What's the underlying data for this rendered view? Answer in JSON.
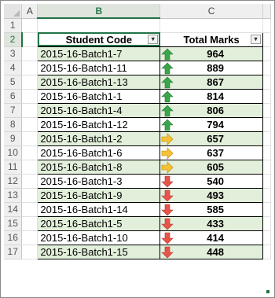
{
  "columns": [
    "A",
    "B",
    "C"
  ],
  "header": {
    "code": "Student Code",
    "marks": "Total Marks"
  },
  "rows": [
    {
      "n": "3",
      "code": "2015-16-Batch1-7",
      "marks": "964",
      "trend": "up"
    },
    {
      "n": "4",
      "code": "2015-16-Batch1-11",
      "marks": "889",
      "trend": "up"
    },
    {
      "n": "5",
      "code": "2015-16-Batch1-13",
      "marks": "867",
      "trend": "up"
    },
    {
      "n": "6",
      "code": "2015-16-Batch1-1",
      "marks": "814",
      "trend": "up"
    },
    {
      "n": "7",
      "code": "2015-16-Batch1-4",
      "marks": "806",
      "trend": "up"
    },
    {
      "n": "8",
      "code": "2015-16-Batch1-12",
      "marks": "794",
      "trend": "up"
    },
    {
      "n": "9",
      "code": "2015-16-Batch1-2",
      "marks": "657",
      "trend": "right"
    },
    {
      "n": "10",
      "code": "2015-16-Batch1-6",
      "marks": "637",
      "trend": "right"
    },
    {
      "n": "11",
      "code": "2015-16-Batch1-8",
      "marks": "605",
      "trend": "right"
    },
    {
      "n": "12",
      "code": "2015-16-Batch1-3",
      "marks": "540",
      "trend": "down"
    },
    {
      "n": "13",
      "code": "2015-16-Batch1-9",
      "marks": "493",
      "trend": "down"
    },
    {
      "n": "14",
      "code": "2015-16-Batch1-14",
      "marks": "585",
      "trend": "down"
    },
    {
      "n": "15",
      "code": "2015-16-Batch1-5",
      "marks": "433",
      "trend": "down"
    },
    {
      "n": "16",
      "code": "2015-16-Batch1-10",
      "marks": "414",
      "trend": "down"
    },
    {
      "n": "17",
      "code": "2015-16-Batch1-15",
      "marks": "448",
      "trend": "down"
    }
  ],
  "row_numbers": {
    "r1": "1",
    "r2": "2"
  },
  "icons": {
    "up": "green-up-arrow-icon",
    "right": "yellow-right-arrow-icon",
    "down": "red-down-arrow-icon"
  },
  "colors": {
    "up": "#3aa54a",
    "right": "#f6c233",
    "down": "#e8534a",
    "band": "#e2efda",
    "accent": "#217346"
  },
  "filter_glyphs": {
    "code": "▾",
    "marks": "▾"
  }
}
